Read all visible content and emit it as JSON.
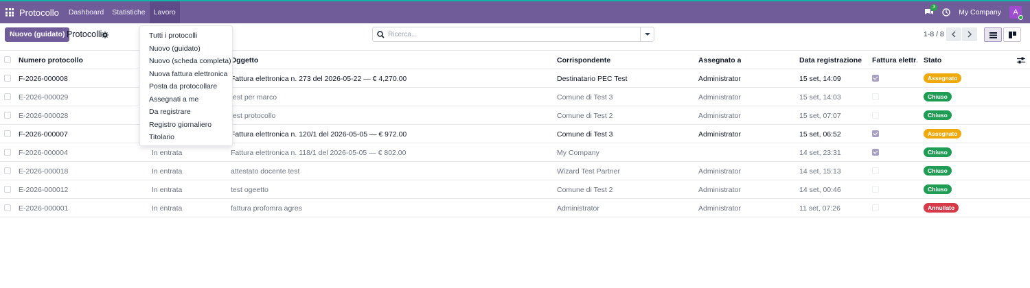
{
  "topbar": {
    "app_name": "Protocollo",
    "nav": [
      "Dashboard",
      "Statistiche",
      "Lavoro"
    ],
    "chat_count": "3",
    "company": "My Company",
    "avatar_letter": "A",
    "bar_color": "#715c9a",
    "accent_color": "#0fb5a6"
  },
  "controls": {
    "new_button": "Nuovo (guidato)",
    "title": "Protocolli",
    "search_placeholder": "Ricerca...",
    "pager": "1-8 / 8"
  },
  "menu": {
    "items": [
      "Tutti i protocolli",
      "Nuovo (guidato)",
      "Nuovo (scheda completa)",
      "Nuova fattura elettronica",
      "Posta da protocollare",
      "Assegnati a me",
      "Da registrare",
      "Registro giornaliero",
      "Titolario"
    ]
  },
  "table": {
    "headers": [
      "Numero protocollo",
      "Oggetto",
      "Corrispondente",
      "Assegnato a",
      "Data registrazione",
      "Fattura elettr…",
      "Stato"
    ],
    "rows": [
      {
        "numero": "F-2026-000008",
        "direzione": "",
        "oggetto": "Fattura elettronica n. 273 del 2026-05-22 — € 4,270.00",
        "corrispondente": "Destinatario PEC Test",
        "assegnato": "Administrator",
        "data": "15 set, 14:09",
        "fattura": true,
        "stato": "Assegnato",
        "style": "bold"
      },
      {
        "numero": "E-2026-000029",
        "direzione": "",
        "oggetto": "test per marco",
        "corrispondente": "Comune di Test 3",
        "assegnato": "Administrator",
        "data": "15 set, 14:03",
        "fattura": false,
        "stato": "Chiuso",
        "style": "muted"
      },
      {
        "numero": "E-2026-000028",
        "direzione": "",
        "oggetto": "test protocollo",
        "corrispondente": "Comune di Test 2",
        "assegnato": "Administrator",
        "data": "15 set, 07:07",
        "fattura": false,
        "stato": "Chiuso",
        "style": "muted"
      },
      {
        "numero": "F-2026-000007",
        "direzione": "",
        "oggetto": "Fattura elettronica n. 120/1 del 2026-05-05 — € 972.00",
        "corrispondente": "Comune di Test 3",
        "assegnato": "Administrator",
        "data": "15 set, 06:52",
        "fattura": true,
        "stato": "Assegnato",
        "style": "bold"
      },
      {
        "numero": "F-2026-000004",
        "direzione": "In entrata",
        "oggetto": "Fattura elettronica n. 118/1 del 2026-05-05 — € 802.00",
        "corrispondente": "My Company",
        "assegnato": "",
        "data": "14 set, 23:31",
        "fattura": true,
        "stato": "Chiuso",
        "style": "muted"
      },
      {
        "numero": "E-2026-000018",
        "direzione": "In entrata",
        "oggetto": "attestato docente test",
        "corrispondente": "Wizard Test Partner",
        "assegnato": "Administrator",
        "data": "14 set, 15:13",
        "fattura": false,
        "stato": "Chiuso",
        "style": "muted"
      },
      {
        "numero": "E-2026-000012",
        "direzione": "In entrata",
        "oggetto": "test ogeetto",
        "corrispondente": "Comune di Test 2",
        "assegnato": "Administrator",
        "data": "14 set, 00:46",
        "fattura": false,
        "stato": "Chiuso",
        "style": "muted"
      },
      {
        "numero": "E-2026-000001",
        "direzione": "In entrata",
        "oggetto": "fattura profomra agres",
        "corrispondente": "Administrator",
        "assegnato": "Administrator",
        "data": "11 set, 07:26",
        "fattura": false,
        "stato": "Annullato",
        "style": "muted"
      }
    ]
  },
  "status_colors": {
    "Assegnato": "#f0a90d",
    "Chiuso": "#1f9d55",
    "Annullato": "#d63a48"
  }
}
